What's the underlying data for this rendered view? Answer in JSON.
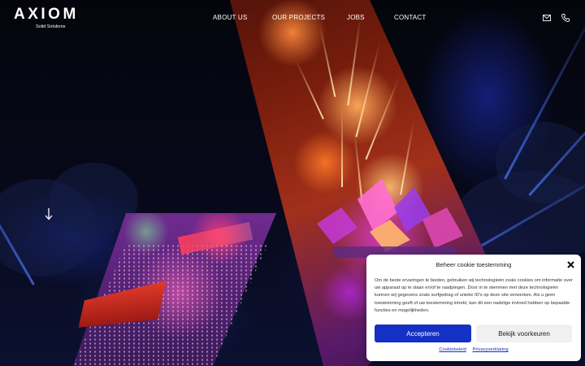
{
  "brand": {
    "name": "AXIOM",
    "tagline": "Solid Solutions"
  },
  "nav": {
    "items": [
      {
        "label": "ABOUT US"
      },
      {
        "label": "OUR PROJECTS"
      },
      {
        "label": "JOBS"
      },
      {
        "label": "CONTACT"
      }
    ],
    "icons": [
      "mail-icon",
      "phone-icon"
    ]
  },
  "hero": {
    "scroll_icon": "arrow-down-icon"
  },
  "cookie_banner": {
    "title": "Beheer cookie toestemming",
    "body": "Om de beste ervaringen te bieden, gebruiken wij technologieën zoals cookies om informatie over uw apparaat op te slaan en/of te raadplegen. Door in te stemmen met deze technologieën kunnen wij gegevens zoals surfgedrag of unieke ID's op deze site verwerken. Als u geen toestemming geeft of uw toestemming intrekt, kan dit een nadelige invloed hebben op bepaalde functies en mogelijkheden.",
    "accept_label": "Accepteren",
    "preferences_label": "Bekijk voorkeuren",
    "links": [
      {
        "label": "Cookiebeleid"
      },
      {
        "label": "Privacyverklaring"
      }
    ],
    "accent_color": "#1530c4"
  }
}
